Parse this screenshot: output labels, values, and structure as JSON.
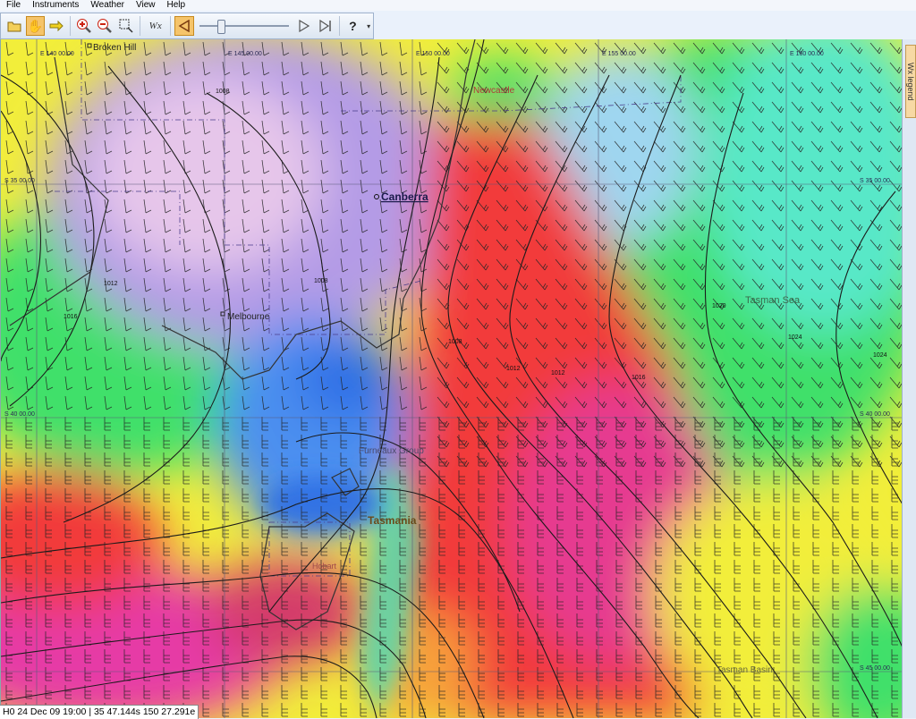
{
  "menu": [
    {
      "label": "File"
    },
    {
      "label": "Instruments"
    },
    {
      "label": "Weather"
    },
    {
      "label": "View"
    },
    {
      "label": "Help"
    }
  ],
  "toolbar": {
    "wx_label": "Wx",
    "help_label": "?"
  },
  "side_tab_label": "Wx legend",
  "status": {
    "text": "H0 24 Dec 09 19:00 | 35 47.144s  150 27.291e"
  },
  "map": {
    "places": [
      {
        "name": "Broken Hill",
        "kind": "town"
      },
      {
        "name": "Canberra",
        "kind": "capital"
      },
      {
        "name": "Melbourne",
        "kind": "town"
      },
      {
        "name": "Newcastle",
        "kind": "town"
      },
      {
        "name": "Furneaux Group",
        "kind": "island"
      },
      {
        "name": "Tasmania",
        "kind": "region"
      },
      {
        "name": "Hobart",
        "kind": "town"
      },
      {
        "name": "Tasman Sea",
        "kind": "sea"
      },
      {
        "name": "Tasman Basin",
        "kind": "sea"
      }
    ],
    "longitude_labels": [
      "E 140 00.00",
      "E 145 00.00",
      "E 150 00.00",
      "E 155 00.00",
      "E 160 00.00"
    ],
    "latitude_labels": [
      "S 35 00.00",
      "S 40 00.00",
      "S 45 00.00"
    ],
    "isobar_labels": [
      "1008",
      "1012",
      "1016",
      "1020",
      "1024"
    ],
    "colors": {
      "calm": "#b49be6",
      "light": "#4c8ff0",
      "moderate": "#3fe06a",
      "fresh": "#f2ee3a",
      "strong": "#f23a3a",
      "gale": "#e63aa6"
    }
  }
}
